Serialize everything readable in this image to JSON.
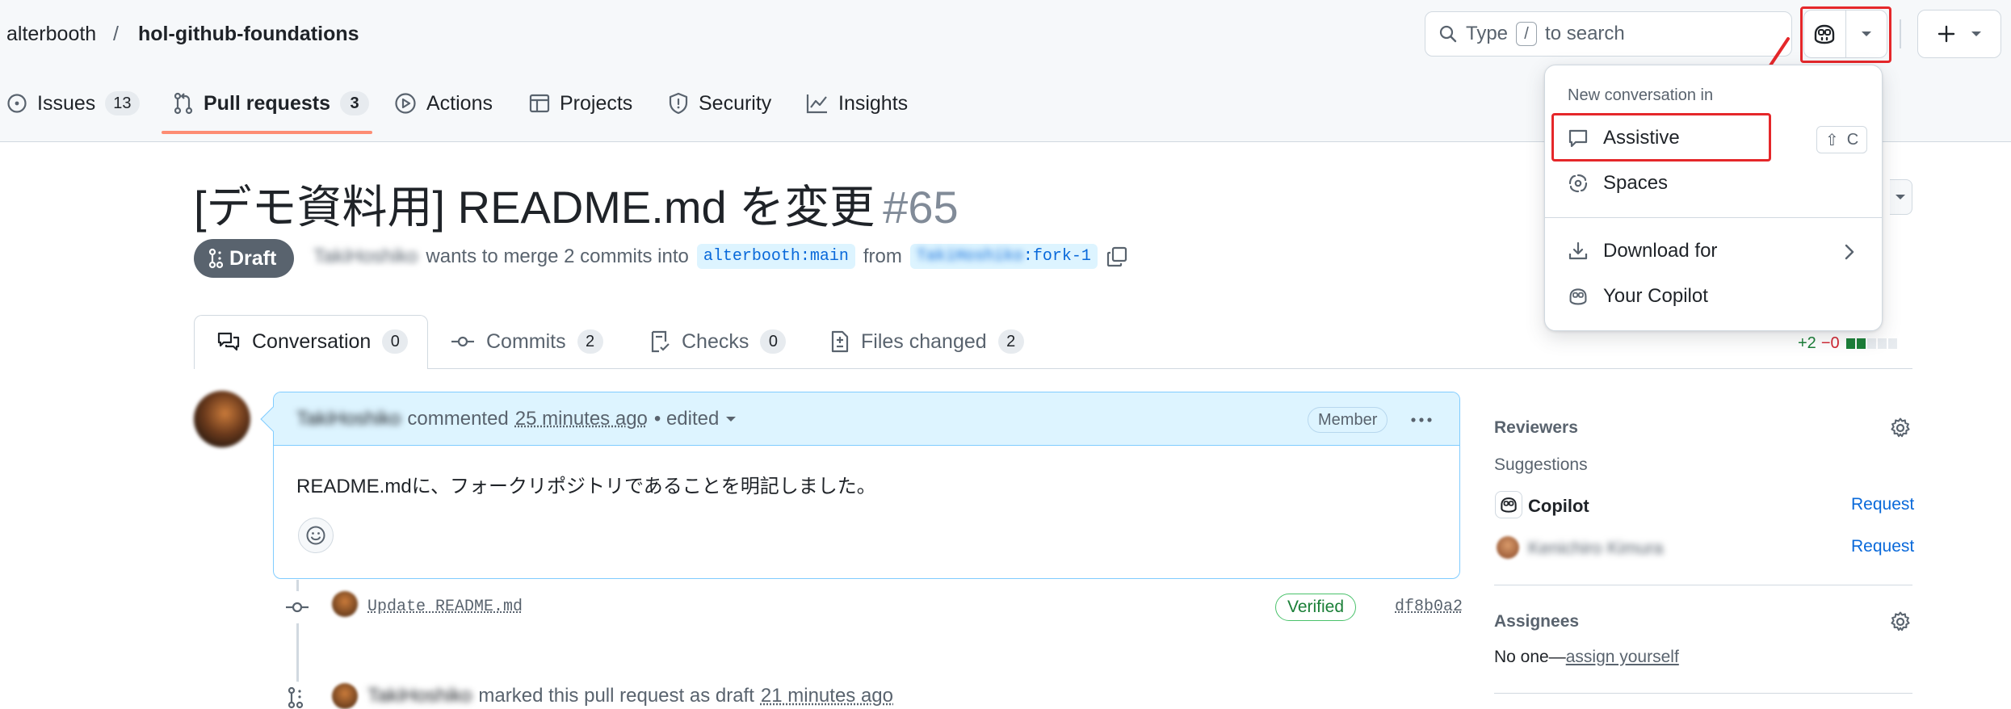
{
  "header": {
    "owner": "alterbooth",
    "separator": "/",
    "repo": "hol-github-foundations",
    "search_prefix": "Type",
    "search_key": "/",
    "search_suffix": "to search"
  },
  "repo_tabs": [
    {
      "label": "Issues",
      "count": "13",
      "icon": "issue-opened-icon"
    },
    {
      "label": "Pull requests",
      "count": "3",
      "icon": "git-pull-request-icon",
      "active": true
    },
    {
      "label": "Actions",
      "icon": "play-icon"
    },
    {
      "label": "Projects",
      "icon": "table-icon"
    },
    {
      "label": "Security",
      "icon": "shield-icon"
    },
    {
      "label": "Insights",
      "icon": "graph-icon"
    }
  ],
  "pr": {
    "title": "[デモ資料用] README.md を変更",
    "number": "#65",
    "state": "Draft",
    "author": "TakiHoshiko",
    "merge_text": "wants to merge 2 commits into",
    "base_branch": "alterbooth:main",
    "from_text": "from",
    "head_owner": "TakiHoshiko",
    "head_branch": ":fork-1"
  },
  "pr_tabs": [
    {
      "label": "Conversation",
      "count": "0",
      "icon": "comment-discussion-icon",
      "active": true
    },
    {
      "label": "Commits",
      "count": "2",
      "icon": "git-commit-icon"
    },
    {
      "label": "Checks",
      "count": "0",
      "icon": "checklist-icon"
    },
    {
      "label": "Files changed",
      "count": "2",
      "icon": "file-diff-icon"
    }
  ],
  "diffstat": {
    "additions": "+2",
    "deletions": "−0",
    "boxes": [
      "green",
      "green",
      "gray",
      "gray",
      "gray"
    ]
  },
  "comment": {
    "author": "TakiHoshiko",
    "action": "commented",
    "time": "25 minutes ago",
    "edited": "• edited",
    "role": "Member",
    "body": "README.mdに、フォークリポジトリであることを明記しました。"
  },
  "timeline": {
    "commit_message": "Update README.md",
    "verified": "Verified",
    "sha": "df8b0a2",
    "draft_actor": "TakiHoshiko",
    "draft_text": "marked this pull request as draft",
    "draft_time": "21 minutes ago"
  },
  "sidebar": {
    "reviewers_heading": "Reviewers",
    "suggestions_label": "Suggestions",
    "reviewers": [
      {
        "name": "Copilot",
        "action": "Request"
      },
      {
        "name": "Kenichiro Kimura",
        "action": "Request"
      }
    ],
    "assignees_heading": "Assignees",
    "no_one": "No one—",
    "assign_yourself": "assign yourself"
  },
  "copilot_menu": {
    "title": "New conversation in",
    "items": [
      {
        "label": "Assistive",
        "icon": "comment-icon",
        "shortcut_key1": "⇧",
        "shortcut_key2": "C"
      },
      {
        "label": "Spaces",
        "icon": "spaces-icon"
      },
      {
        "label": "Download for",
        "icon": "download-icon"
      },
      {
        "label": "Your Copilot",
        "icon": "copilot-icon"
      }
    ]
  },
  "colors": {
    "accent": "#0969da",
    "tab_underline": "#fd8c73",
    "highlight_red": "#e5272a",
    "verified_green": "#1a7f37"
  }
}
